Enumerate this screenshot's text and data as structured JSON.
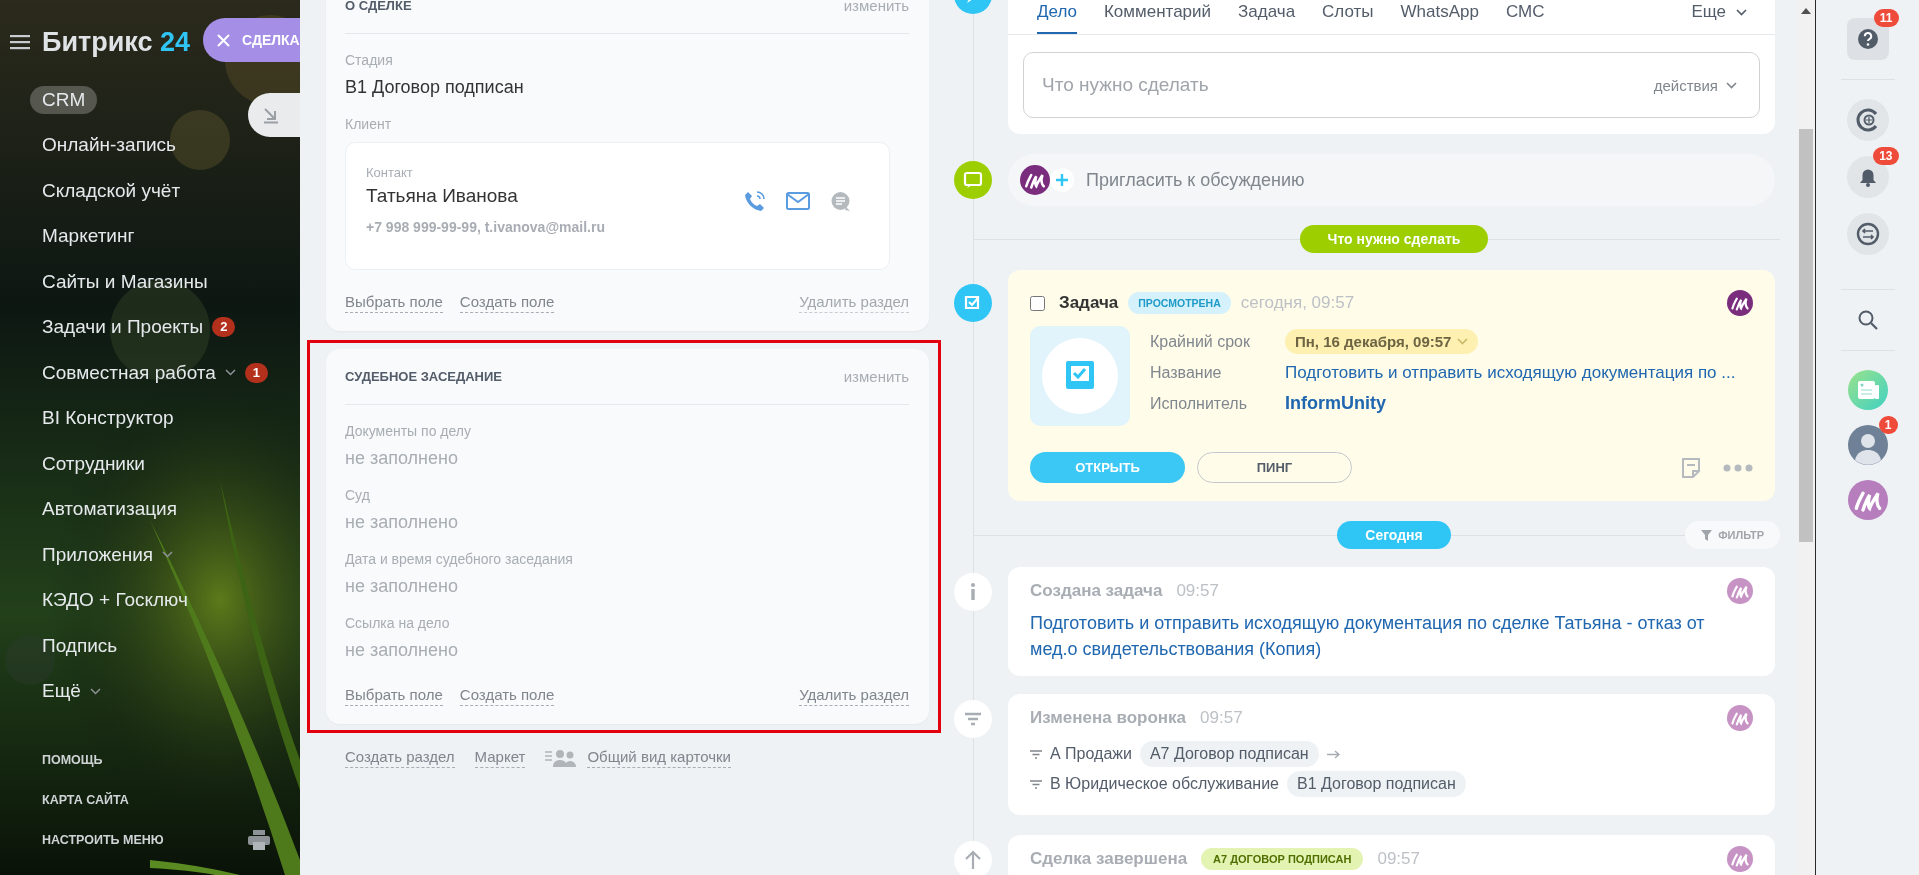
{
  "sidebar": {
    "logo": {
      "name": "Битрикс",
      "number": "24"
    },
    "items": [
      {
        "label": "CRM",
        "selected": true,
        "expandable": false
      },
      {
        "label": "Онлайн-запись",
        "selected": false,
        "expandable": false
      },
      {
        "label": "Складской учёт",
        "selected": false,
        "expandable": false
      },
      {
        "label": "Маркетинг",
        "selected": false,
        "expandable": false
      },
      {
        "label": "Сайты и Магазины",
        "selected": false,
        "expandable": false
      },
      {
        "label": "Задачи и Проекты",
        "selected": false,
        "expandable": false,
        "badge": "2"
      },
      {
        "label": "Совместная работа",
        "selected": false,
        "expandable": true,
        "badge": "1"
      },
      {
        "label": "BI Конструктор",
        "selected": false,
        "expandable": false
      },
      {
        "label": "Сотрудники",
        "selected": false,
        "expandable": false
      },
      {
        "label": "Автоматизация",
        "selected": false,
        "expandable": false
      },
      {
        "label": "Приложения",
        "selected": false,
        "expandable": true
      },
      {
        "label": "КЭДО + Госключ",
        "selected": false,
        "expandable": false
      },
      {
        "label": "Подпись",
        "selected": false,
        "expandable": false
      },
      {
        "label": "Ещё",
        "selected": false,
        "expandable": true
      }
    ],
    "footer_links": [
      "ПОМОЩЬ",
      "КАРТА САЙТА",
      "НАСТРОИТЬ МЕНЮ"
    ]
  },
  "slider_tabs": [
    {
      "kind": "close",
      "label": "СДЕЛКА"
    },
    {
      "kind": "minimize"
    }
  ],
  "sections": [
    {
      "title": "О СДЕЛКЕ",
      "edit_link": "изменить",
      "highlighted": false,
      "fields": [
        {
          "kind": "text",
          "label": "Стадия",
          "value": "В1 Договор подписан",
          "empty": false
        },
        {
          "kind": "client",
          "label": "Клиент",
          "contact": {
            "caption": "Контакт",
            "name": "Татьяна Иванова",
            "details": "+7 998 999-99-99, t.ivanova@mail.ru"
          }
        }
      ],
      "actions": [
        {
          "label": "Выбрать поле",
          "disabled": false
        },
        {
          "label": "Создать поле",
          "disabled": false
        },
        {
          "label": "Удалить раздел",
          "disabled": true
        }
      ]
    },
    {
      "title": "СУДЕБНОЕ ЗАСЕДАНИЕ",
      "edit_link": "изменить",
      "highlighted": true,
      "fields": [
        {
          "kind": "text",
          "label": "Документы по делу",
          "value": "не заполнено",
          "empty": true
        },
        {
          "kind": "text",
          "label": "Суд",
          "value": "не заполнено",
          "empty": true
        },
        {
          "kind": "text",
          "label": "Дата и время судебного заседания",
          "value": "не заполнено",
          "empty": true
        },
        {
          "kind": "text",
          "label": "Ссылка на дело",
          "value": "не заполнено",
          "empty": true
        }
      ],
      "actions": [
        {
          "label": "Выбрать поле",
          "disabled": false
        },
        {
          "label": "Создать поле",
          "disabled": false
        },
        {
          "label": "Удалить раздел",
          "disabled": false
        }
      ]
    }
  ],
  "section_footer": [
    {
      "kind": "link",
      "label": "Создать раздел"
    },
    {
      "kind": "link",
      "label": "Маркет"
    },
    {
      "kind": "view",
      "label": "Общий вид карточки"
    }
  ],
  "timeline": {
    "composer": {
      "tabs": [
        {
          "label": "Дело",
          "selected": true
        },
        {
          "label": "Комментарий",
          "selected": false
        },
        {
          "label": "Задача",
          "selected": false
        },
        {
          "label": "Слоты",
          "selected": false
        },
        {
          "label": "WhatsApp",
          "selected": false
        },
        {
          "label": "СМС",
          "selected": false
        }
      ],
      "more": "Еще",
      "placeholder": "Что нужно сделать",
      "actions": "действия"
    },
    "invite": "Пригласить к обсуждению",
    "items": [
      {
        "kind": "divider",
        "label": "Что нужно сделать",
        "color": "#9dcf00"
      },
      {
        "kind": "task",
        "title": "Задача",
        "checked": false,
        "status": "ПРОСМОТРЕНА",
        "time": "сегодня, 09:57",
        "fields": [
          {
            "kind": "deadline",
            "label": "Крайний срок",
            "value": "Пн, 16 декабря, 09:57"
          },
          {
            "kind": "link",
            "label": "Название",
            "value": "Подготовить и отправить исходящую документация по ..."
          },
          {
            "kind": "person",
            "label": "Исполнитель",
            "value": "InformUnity"
          }
        ],
        "buttons": [
          {
            "kind": "primary",
            "label": "ОТКРЫТЬ"
          },
          {
            "kind": "secondary",
            "label": "ПИНГ"
          }
        ]
      },
      {
        "kind": "divider",
        "label": "Сегодня",
        "color": "#2fc6f6",
        "filter": "ФИЛЬТР"
      },
      {
        "kind": "created",
        "title": "Создана задача",
        "time": "09:57",
        "text": "Подготовить и отправить исходящую документация по сделке Татьяна - отказ от мед.о свидетельствования (Копия)"
      },
      {
        "kind": "funnel",
        "title": "Изменена воронка",
        "time": "09:57",
        "rows": [
          {
            "funnel": "А Продажи",
            "stage": "А7 Договор подписан",
            "arrow": true
          },
          {
            "funnel": "В Юридическое обслуживание",
            "stage": "В1 Договор подписан",
            "arrow": false
          }
        ]
      },
      {
        "kind": "closed",
        "title": "Сделка завершена",
        "tag": "А7 ДОГОВОР ПОДПИСАН",
        "time": "09:57"
      }
    ]
  },
  "rail": [
    {
      "kind": "help",
      "badge": "11"
    },
    {
      "kind": "copilot"
    },
    {
      "kind": "bell",
      "badge": "13"
    },
    {
      "kind": "chat"
    },
    {
      "kind": "search"
    },
    {
      "kind": "news"
    },
    {
      "kind": "user",
      "badge": "1"
    },
    {
      "kind": "logo"
    }
  ]
}
